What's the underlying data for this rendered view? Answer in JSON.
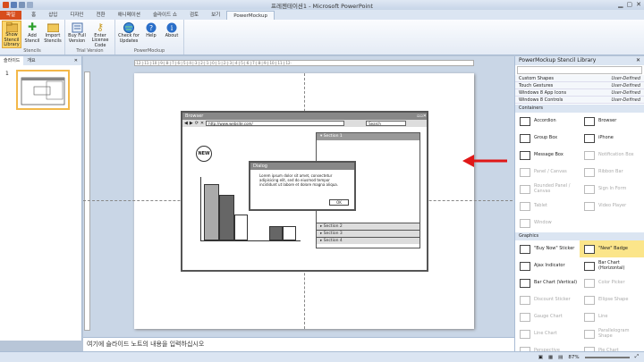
{
  "title": "프레젠테이션1 - Microsoft PowerPoint",
  "tabs": [
    "파일",
    "홈",
    "삽입",
    "디자인",
    "전환",
    "애니메이션",
    "슬라이드 쇼",
    "검토",
    "보기",
    "PowerMockup"
  ],
  "ribbon": {
    "groups": [
      {
        "label": "Stencils",
        "buttons": [
          "Show Stencil Library",
          "Add Stencil",
          "Import Stencils"
        ]
      },
      {
        "label": "Trial Version",
        "buttons": [
          "Buy Full Version",
          "Enter License Code"
        ]
      },
      {
        "label": "PowerMockup",
        "buttons": [
          "Check for Updates",
          "Help",
          "About"
        ]
      }
    ]
  },
  "left_pane": {
    "tabs": [
      "슬라이드",
      "개요"
    ],
    "slide_number": "1"
  },
  "ruler_text": "·12·|·11·|·10·|·9·|·8·|·7·|·6·|·5·|·4·|·3·|·2·|·1·|·0·|·1·|·2·|·3·|·4·|·5·|·6·|·7·|·8·|·9·|·10·|·11·|·12·",
  "slide": {
    "browser_title": "Browser",
    "url": "http://www.website.com/",
    "search_placeholder": "Search",
    "new_badge": "NEW",
    "sections": [
      "Section 1",
      "Section 2",
      "Section 3",
      "Section 4"
    ],
    "dialog_title": "Dialog",
    "dialog_text": "Lorem ipsum dolor sit amet, consectetur adipisicing elit, sed do eiusmod tempor incididunt ut labore et dolore magna aliqua.",
    "dialog_ok": "OK"
  },
  "notes_placeholder": "여기에 슬라이드 노트의 내용을 입력하십시오",
  "status": {
    "zoom": "87%"
  },
  "stencil": {
    "title": "PowerMockup Stencil Library",
    "categories": [
      {
        "name": "Custom Shapes",
        "tag": "User-Defined"
      },
      {
        "name": "Touch Gestures",
        "tag": "User-Defined"
      },
      {
        "name": "Windows 8 App Icons",
        "tag": "User-Defined"
      },
      {
        "name": "Windows 8 Controls",
        "tag": "User-Defined"
      }
    ],
    "containers_label": "Containers",
    "containers": [
      {
        "label": "Accordion",
        "disabled": false
      },
      {
        "label": "Browser",
        "disabled": false
      },
      {
        "label": "Group Box",
        "disabled": false
      },
      {
        "label": "iPhone",
        "disabled": false
      },
      {
        "label": "Message Box",
        "disabled": false
      },
      {
        "label": "Notification Box",
        "disabled": true
      },
      {
        "label": "Panel / Canvas",
        "disabled": true
      },
      {
        "label": "Ribbon Bar",
        "disabled": true
      },
      {
        "label": "Rounded Panel / Canvas",
        "disabled": true
      },
      {
        "label": "Sign In Form",
        "disabled": true
      },
      {
        "label": "Tablet",
        "disabled": true
      },
      {
        "label": "Video Player",
        "disabled": true
      },
      {
        "label": "Window",
        "disabled": true
      }
    ],
    "graphics_label": "Graphics",
    "graphics": [
      {
        "label": "\"Buy Now\" Sticker",
        "disabled": false
      },
      {
        "label": "\"New\" Badge",
        "disabled": false,
        "highlight": true
      },
      {
        "label": "Ajax Indicator",
        "disabled": false
      },
      {
        "label": "Bar Chart (Horizontal)",
        "disabled": false
      },
      {
        "label": "Bar Chart (Vertical)",
        "disabled": false
      },
      {
        "label": "Color Picker",
        "disabled": true
      },
      {
        "label": "Discount Sticker",
        "disabled": true
      },
      {
        "label": "Ellipse Shape",
        "disabled": true
      },
      {
        "label": "Gauge Chart",
        "disabled": true
      },
      {
        "label": "Line",
        "disabled": true
      },
      {
        "label": "Line Chart",
        "disabled": true
      },
      {
        "label": "Parallelogram Shape",
        "disabled": true
      },
      {
        "label": "Perspective",
        "disabled": true
      },
      {
        "label": "Pie Chart",
        "disabled": true
      }
    ]
  },
  "colors": {
    "accent": "#d74d1c",
    "arrow": "#e01818",
    "highlight": "#fbd56b"
  }
}
